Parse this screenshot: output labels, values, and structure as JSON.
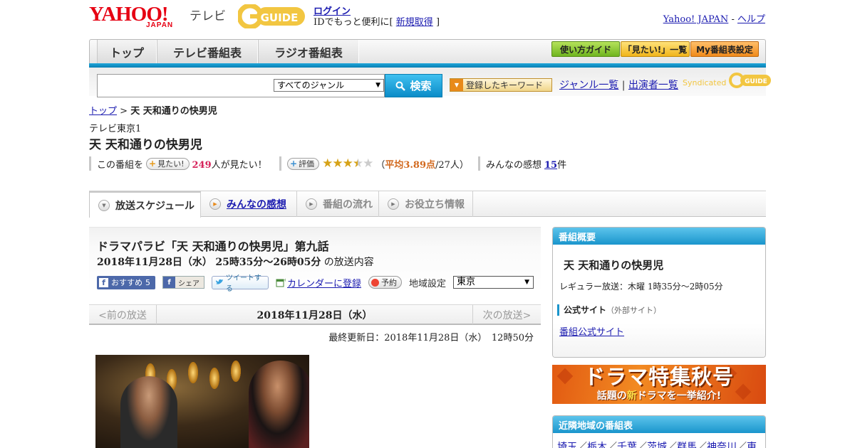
{
  "header": {
    "logo_main": "YAHOO!",
    "logo_sub": "JAPAN",
    "logo_tv": "テレビ",
    "logo_gguide": "G-GUIDE",
    "login_label": "ログイン",
    "login_prefix": "IDでもっと便利に[",
    "register_label": "新規取得",
    "login_suffix": "]",
    "yahoo_japan_link": "Yahoo! JAPAN",
    "help_link": "ヘルプ",
    "separator": " - "
  },
  "nav": {
    "tabs": [
      "トップ",
      "テレビ番組表",
      "ラジオ番組表"
    ],
    "guide_buttons": [
      "使い方ガイド",
      "「見たい!」一覧",
      "My番組表設定"
    ]
  },
  "search": {
    "placeholder": "",
    "genre_selected": "すべてのジャンル",
    "button_label": "検索",
    "keyword_button": "登録したキーワード",
    "genre_list_link": "ジャンル一覧",
    "divider": "|",
    "performer_list_link": "出演者一覧",
    "syndicated": "Syndicated"
  },
  "breadcrumb": {
    "top": "トップ",
    "sep": ">",
    "current": "天 天和通りの快男児"
  },
  "program": {
    "station": "テレビ東京1",
    "title": "天 天和通りの快男児",
    "want_prefix": "この番組を",
    "want_button": "見たい!",
    "want_count": "249",
    "want_suffix": "人が見たい！",
    "rate_button": "評価",
    "rating_value": 3.89,
    "rating_open": "（",
    "rating_avg": "平均3.89点",
    "rating_count": "/27人）",
    "impressions_label": "みんなの感想",
    "impressions_count": "15",
    "impressions_unit": "件"
  },
  "tabs": {
    "schedule": "放送スケジュール",
    "impressions": "みんなの感想",
    "flow": "番組の流れ",
    "info": "お役立ち情報"
  },
  "episode": {
    "title": "ドラマパラビ「天 天和通りの快男児」第九話",
    "date": "2018年11月28日（水）",
    "time": "25時35分～26時05分",
    "suffix": "の放送内容",
    "fb_recommend": "おすすめ",
    "fb_count": "5",
    "fb_share": "シェア",
    "tweet": "ツイートする",
    "calendar": "カレンダーに登録",
    "reserve": "予約",
    "region_label": "地域設定",
    "region_selected": "東京"
  },
  "pager": {
    "prev": "<前の放送",
    "current": "2018年11月28日（水）",
    "next": "次の放送>"
  },
  "updated": "最終更新日：2018年11月28日（水）　12時50分",
  "sidebar": {
    "overview_header": "番組概要",
    "overview_title": "天 天和通りの快男児",
    "regular": "レギュラー放送：木曜 1時35分～2時05分",
    "official_label": "公式サイト",
    "official_note": "（外部サイト）",
    "official_link": "番組公式サイト",
    "banner_line1": "ドラマ特集秋号",
    "banner_line2_pre": "話題の",
    "banner_line2_new": "新",
    "banner_line2_post": "ドラマを一挙紹介!",
    "neighbors_header": "近隣地域の番組表",
    "neighbors": [
      "埼玉",
      "栃木",
      "千葉",
      "茨城",
      "群馬",
      "神奈川",
      "東"
    ]
  },
  "colors": {
    "accent_blue": "#1a95cc",
    "link": "#1b1bb0",
    "brand_red": "#e60012",
    "star": "#d6a217"
  }
}
